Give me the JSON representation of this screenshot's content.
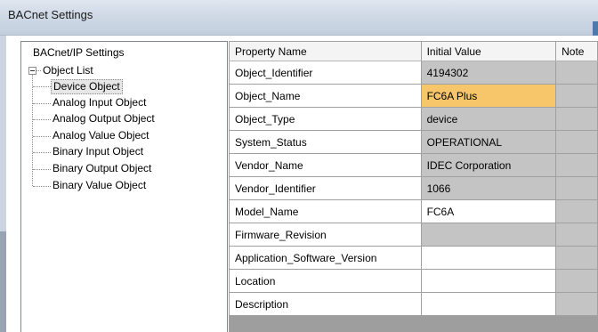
{
  "window": {
    "title": "BACnet Settings"
  },
  "tree": {
    "root_item": "BACnet/IP Settings",
    "object_list": "Object List",
    "children": [
      "Device Object",
      "Analog Input Object",
      "Analog Output Object",
      "Analog Value Object",
      "Binary Input Object",
      "Binary Output Object",
      "Binary Value Object"
    ],
    "selected": "Device Object"
  },
  "grid": {
    "headers": [
      "Property Name",
      "Initial Value",
      "Note"
    ],
    "rows": [
      {
        "name": "Object_Identifier",
        "value": "4194302",
        "editable": false
      },
      {
        "name": "Object_Name",
        "value": "FC6A Plus",
        "editable": true,
        "selected": true
      },
      {
        "name": "Object_Type",
        "value": "device",
        "editable": false
      },
      {
        "name": "System_Status",
        "value": "OPERATIONAL",
        "editable": false
      },
      {
        "name": "Vendor_Name",
        "value": "IDEC Corporation",
        "editable": false
      },
      {
        "name": "Vendor_Identifier",
        "value": "1066",
        "editable": false
      },
      {
        "name": "Model_Name",
        "value": "FC6A",
        "editable": true
      },
      {
        "name": "Firmware_Revision",
        "value": "",
        "editable": false
      },
      {
        "name": "Application_Software_Version",
        "value": "",
        "editable": true
      },
      {
        "name": "Location",
        "value": "",
        "editable": true
      },
      {
        "name": "Description",
        "value": "",
        "editable": true
      }
    ]
  },
  "colors": {
    "readonly_cell": "#c4c4c4",
    "selected_cell": "#f7c56a",
    "editable_cell": "#ffffff"
  }
}
